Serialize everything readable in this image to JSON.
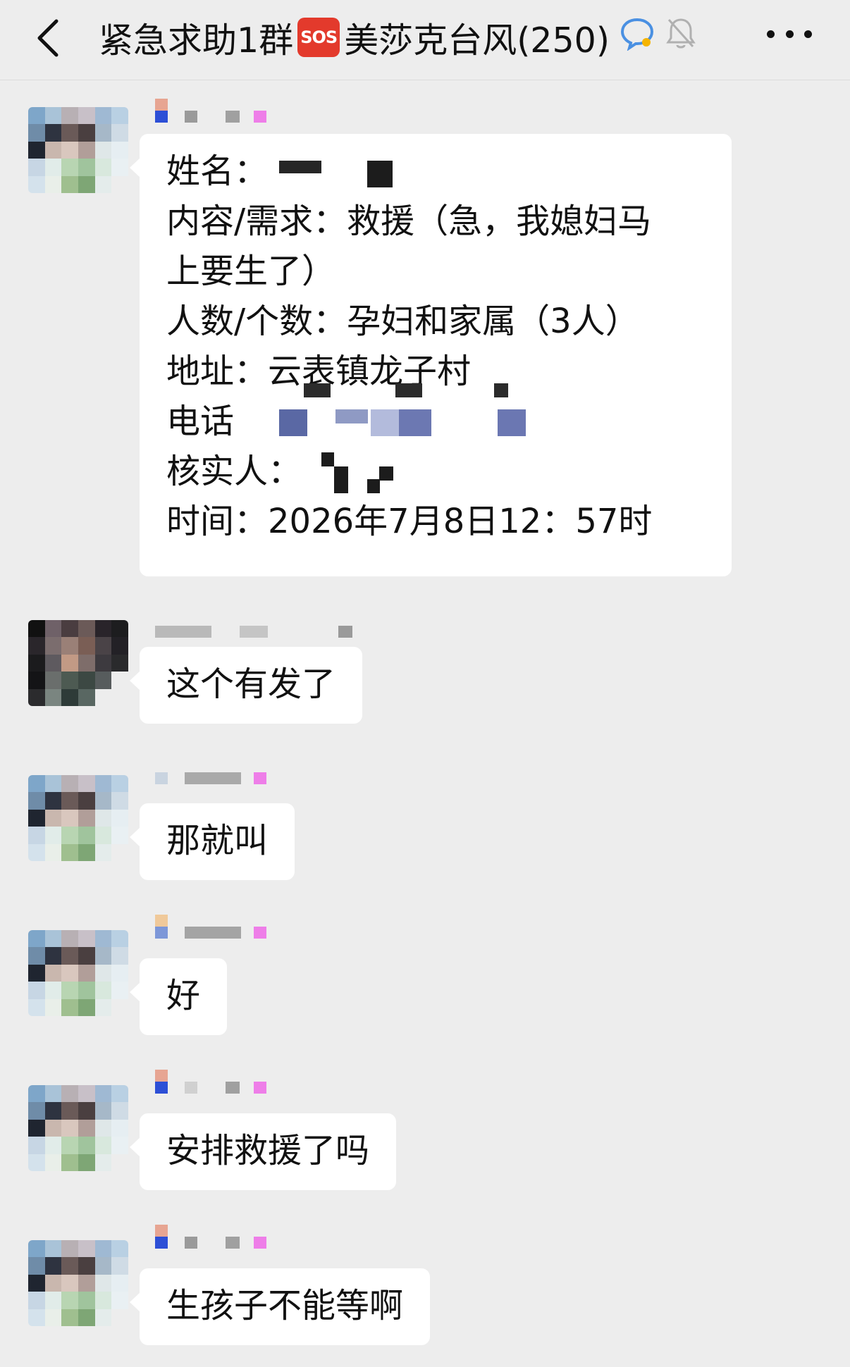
{
  "header": {
    "title": "紧急求助1群",
    "sos_badge": "SOS",
    "title_suffix": "美莎克台风(250)",
    "back_icon": "chevron-left-icon",
    "chat_icon": "chat-bubble-icon",
    "mute_icon": "bell-muted-icon",
    "more_icon": "more-dots-icon"
  },
  "messages": [
    {
      "lines": [
        "姓名：",
        "内容/需求：救援（急，我媳妇马",
        "上要生了）",
        "人数/个数：孕妇和家属（3人）",
        "地址：云表镇龙子村",
        "电话",
        "核实人：",
        "时间：2026年7月8日12：57时"
      ]
    },
    {
      "text": "这个有发了"
    },
    {
      "text": "那就叫"
    },
    {
      "text": "好"
    },
    {
      "text": "安排救援了吗"
    },
    {
      "text": "生孩子不能等啊"
    }
  ],
  "colors": {
    "background": "#ededed",
    "bubble": "#ffffff",
    "sos": "#e33a2c",
    "pixel_blue": "#2d4fd6",
    "pixel_pink": "#ee7ee8"
  }
}
